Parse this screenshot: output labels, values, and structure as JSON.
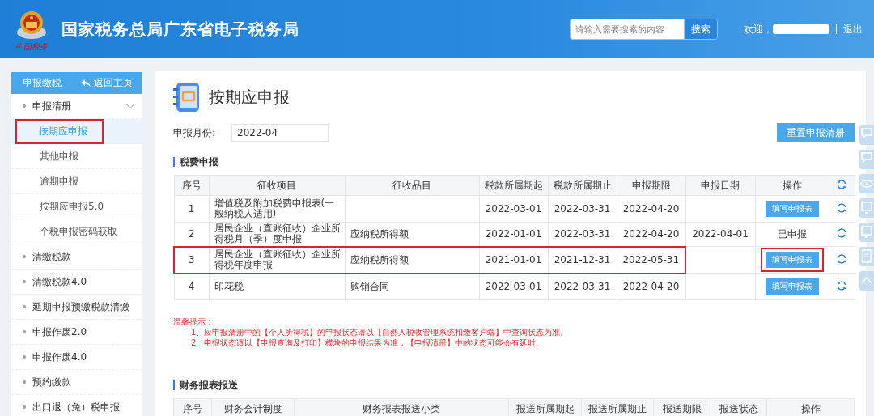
{
  "header": {
    "title": "国家税务总局广东省电子税务局",
    "logo_caption": "中国税务",
    "search": {
      "placeholder": "请输入需要搜索的内容",
      "button": "搜索"
    },
    "welcome": "欢迎，",
    "logout": "退出"
  },
  "sidebar": {
    "title": "申报缴税",
    "back_link": "返回主页",
    "items": [
      {
        "label": "申报清册",
        "expanded": true,
        "children": [
          {
            "label": "按期应申报",
            "selected": true,
            "highlighted": true
          },
          {
            "label": "其他申报",
            "selected": false,
            "highlighted": false
          },
          {
            "label": "逾期申报",
            "selected": false,
            "highlighted": false
          },
          {
            "label": "按期应申报5.0",
            "selected": false,
            "highlighted": false
          },
          {
            "label": "个税申报密码获取",
            "selected": false,
            "highlighted": false
          }
        ]
      },
      {
        "label": "清缴税款"
      },
      {
        "label": "清缴税款4.0"
      },
      {
        "label": "延期申报预缴税款清缴"
      },
      {
        "label": "申报作废2.0"
      },
      {
        "label": "申报作废4.0"
      },
      {
        "label": "预约缴款"
      },
      {
        "label": "出口退（免）税申报"
      }
    ]
  },
  "page": {
    "title": "按期应申报",
    "month_label": "申报月份:",
    "month_value": "2022-04",
    "reset_button": "重置申报清册"
  },
  "tax_section": {
    "title": "税费申报",
    "columns": [
      "序号",
      "征收项目",
      "征收品目",
      "税款所属期起",
      "税款所属期止",
      "申报期限",
      "申报日期",
      "操作"
    ],
    "rows": [
      {
        "no": "1",
        "item": "增值税及附加税费申报表(一般纳税人适用)",
        "category": "",
        "start": "2022-03-01",
        "end": "2022-03-31",
        "deadline": "2022-04-20",
        "date": "",
        "action": {
          "kind": "button",
          "label": "填写申报表",
          "highlighted": false
        },
        "highlighted": false
      },
      {
        "no": "2",
        "item": "居民企业（查账征收）企业所得税月（季）度申报",
        "category": "应纳税所得额",
        "start": "2022-01-01",
        "end": "2022-03-31",
        "deadline": "2022-04-20",
        "date": "2022-04-01",
        "action": {
          "kind": "text",
          "label": "已申报",
          "highlighted": false
        },
        "highlighted": false
      },
      {
        "no": "3",
        "item": "居民企业（查账征收）企业所得税年度申报",
        "category": "应纳税所得额",
        "start": "2021-01-01",
        "end": "2021-12-31",
        "deadline": "2022-05-31",
        "date": "",
        "action": {
          "kind": "button",
          "label": "填写申报表",
          "highlighted": true
        },
        "highlighted": true
      },
      {
        "no": "4",
        "item": "印花税",
        "category": "购销合同",
        "start": "2022-03-01",
        "end": "2022-03-31",
        "deadline": "2022-04-20",
        "date": "",
        "action": {
          "kind": "button",
          "label": "填写申报表",
          "highlighted": false
        },
        "highlighted": false
      }
    ]
  },
  "notice": {
    "title": "温馨提示：",
    "lines": [
      "1、应申报清册中的【个人所得税】的申报状态请以【自然人税收管理系统扣缴客户端】中查询状态为准。",
      "2、申报状态请以【申报查询及打印】模块的申报结果为准，【申报清册】中的状态可能会有延时。"
    ]
  },
  "finance_section": {
    "title": "财务报表报送",
    "columns": [
      "序号",
      "财务会计制度",
      "财务报表报送小类",
      "报送所属期起",
      "报送所属期止",
      "报送期限",
      "报送状态",
      "操作"
    ]
  }
}
